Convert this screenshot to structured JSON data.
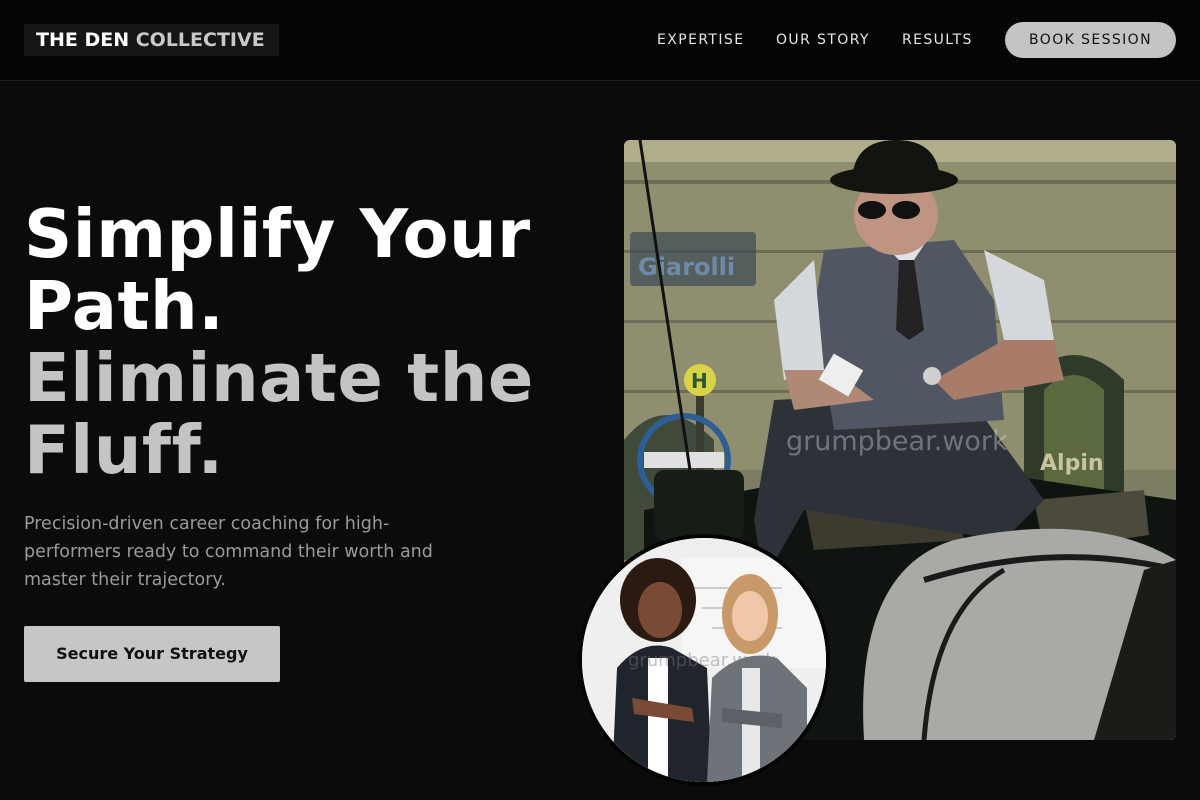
{
  "header": {
    "logo_part1": "THE DEN",
    "logo_part2": "COLLECTIVE",
    "nav": [
      "EXPERTISE",
      "OUR STORY",
      "RESULTS"
    ],
    "cta_label": "BOOK SESSION"
  },
  "hero": {
    "headline_line1": "Simplify Your Path.",
    "headline_line2": "Eliminate the Fluff.",
    "subtext": "Precision-driven career coaching for high-performers ready to command their worth and master their trajectory.",
    "cta_label": "Secure Your Strategy"
  },
  "images": {
    "main_photo_sign": "Giarolli",
    "main_photo_sign2": "Alpin",
    "main_photo_sign3": "H",
    "watermark": "grumpbear.work",
    "main_photo_icon": "coachman-photo",
    "circle_photo_icon": "two-women-photo"
  },
  "colors": {
    "background": "#0b0b0b",
    "header": "#050505",
    "accent": "#c4c4c4",
    "muted_text": "#9a9a9a"
  }
}
